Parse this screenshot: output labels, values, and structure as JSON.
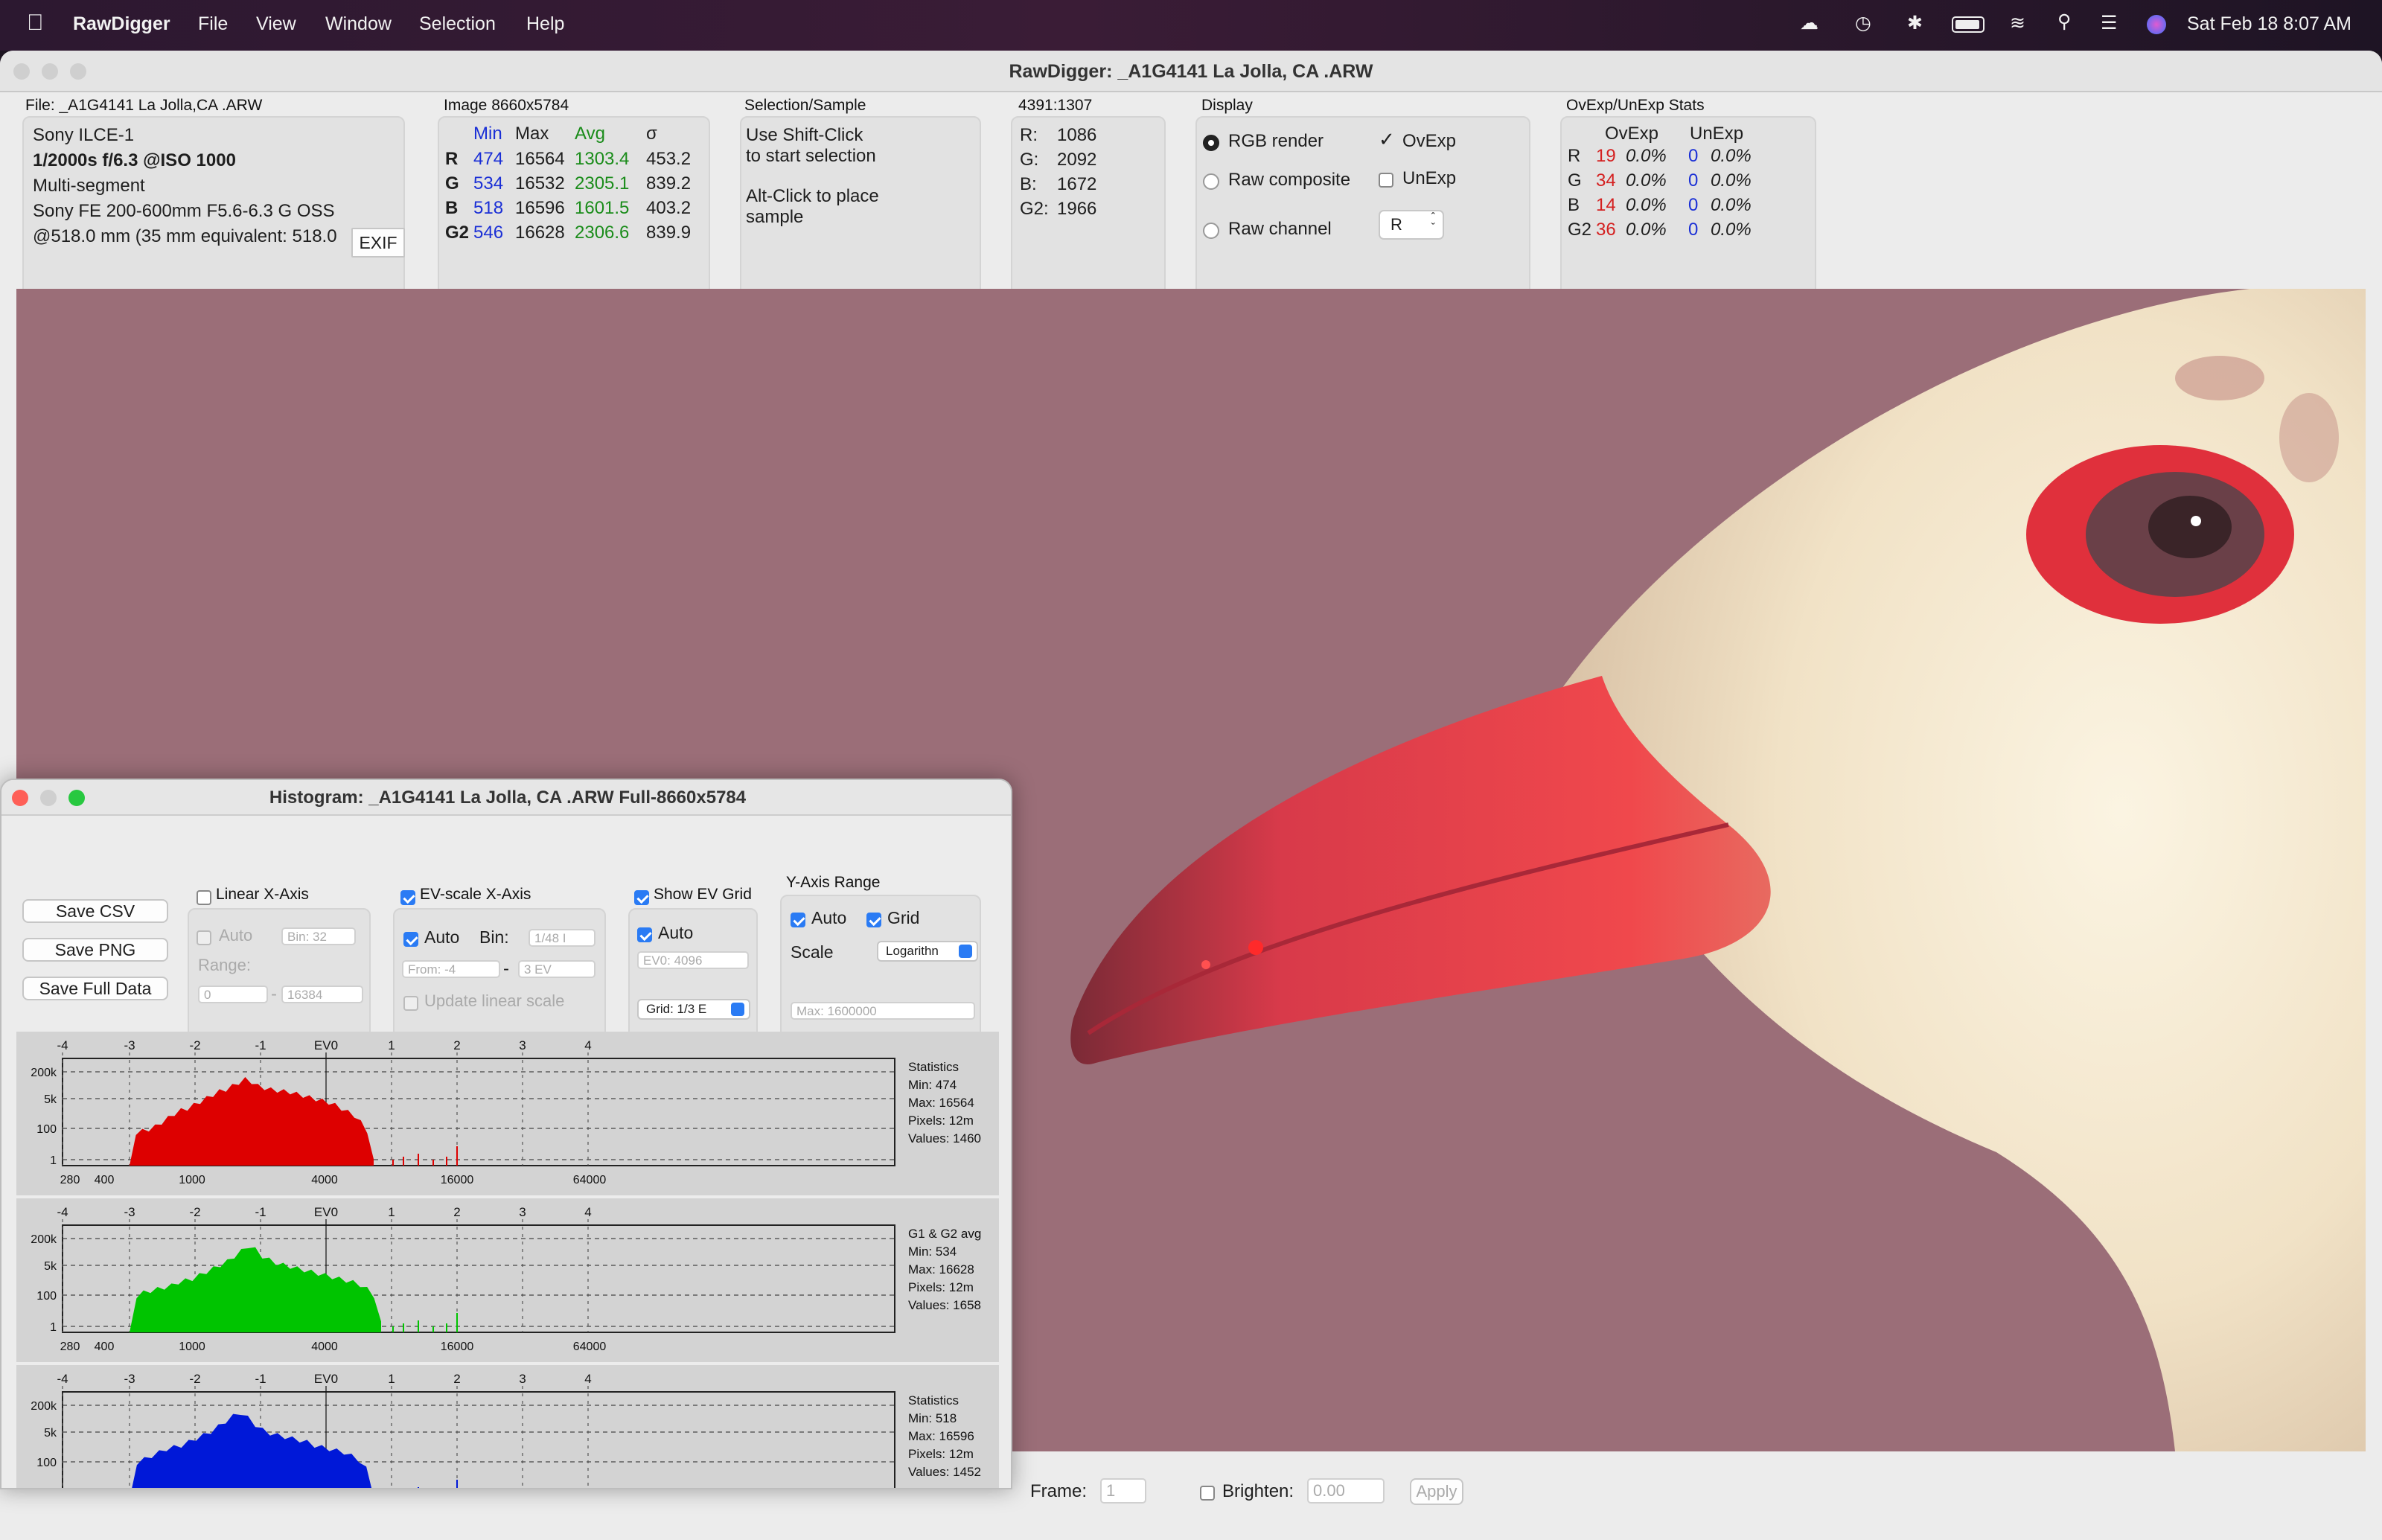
{
  "menubar": {
    "app": "RawDigger",
    "items": [
      "File",
      "View",
      "Window",
      "Selection",
      "Help"
    ],
    "clock": "Sat Feb 18  8:07 AM"
  },
  "window": {
    "title": "RawDigger: _A1G4141 La Jolla, CA .ARW"
  },
  "file_info": {
    "header": "File: _A1G4141 La Jolla,CA .ARW",
    "lines": [
      "Sony ILCE-1",
      "1/2000s f/6.3 @ISO 1000",
      "Multi-segment",
      "Sony FE 200-600mm F5.6-6.3 G OSS",
      "@518.0 mm (35 mm equivalent: 518.0"
    ],
    "exif_button": "EXIF"
  },
  "image_stats": {
    "header": "Image 8660x5784",
    "columns": [
      "Min",
      "Max",
      "Avg",
      "σ"
    ],
    "rows": [
      {
        "ch": "R",
        "min": "474",
        "max": "16564",
        "avg": "1303.4",
        "sd": "453.2"
      },
      {
        "ch": "G",
        "min": "534",
        "max": "16532",
        "avg": "2305.1",
        "sd": "839.2"
      },
      {
        "ch": "B",
        "min": "518",
        "max": "16596",
        "avg": "1601.5",
        "sd": "403.2"
      },
      {
        "ch": "G2",
        "min": "546",
        "max": "16628",
        "avg": "2306.6",
        "sd": "839.9"
      }
    ]
  },
  "selection": {
    "header": "Selection/Sample",
    "line1": "Use Shift-Click",
    "line2": "to start selection",
    "line3": "Alt-Click to place",
    "line4": "sample"
  },
  "pixel": {
    "header": "4391:1307",
    "rows": [
      {
        "ch": "R:",
        "v": "1086"
      },
      {
        "ch": "G:",
        "v": "2092"
      },
      {
        "ch": "B:",
        "v": "1672"
      },
      {
        "ch": "G2:",
        "v": "1966"
      }
    ]
  },
  "display": {
    "header": "Display",
    "rgb_render": "RGB render",
    "raw_composite": "Raw composite",
    "raw_channel": "Raw channel",
    "ovexp": "OvExp",
    "unexp": "UnExp",
    "channel_select": "R"
  },
  "ovexp_stats": {
    "header": "OvExp/UnExp Stats",
    "col1": "OvExp",
    "col2": "UnExp",
    "rows": [
      {
        "ch": "R",
        "ov": "19",
        "ovp": "0.0%",
        "un": "0",
        "unp": "0.0%"
      },
      {
        "ch": "G",
        "ov": "34",
        "ovp": "0.0%",
        "un": "0",
        "unp": "0.0%"
      },
      {
        "ch": "B",
        "ov": "14",
        "ovp": "0.0%",
        "un": "0",
        "unp": "0.0%"
      },
      {
        "ch": "G2",
        "ov": "36",
        "ovp": "0.0%",
        "un": "0",
        "unp": "0.0%"
      }
    ]
  },
  "bottom": {
    "frame_label": "Frame:",
    "frame_value": "1",
    "brighten_label": "Brighten:",
    "brighten_value": "0.00",
    "apply": "Apply"
  },
  "histogram": {
    "title": "Histogram: _A1G4141 La Jolla, CA .ARW Full-8660x5784",
    "buttons": [
      "Save CSV",
      "Save PNG",
      "Save Full Data"
    ],
    "linear": {
      "label": "Linear X-Axis",
      "auto": "Auto",
      "bin": "Bin: 32",
      "range": "Range:",
      "from": "0",
      "to": "16384"
    },
    "ev": {
      "label": "EV-scale X-Axis",
      "auto": "Auto",
      "bin_label": "Bin:",
      "bin": "1/48 I",
      "from": "From: -4",
      "to": "3 EV",
      "update": "Update linear scale"
    },
    "evgrid": {
      "label": "Show EV Grid",
      "auto": "Auto",
      "ev0": "EV0: 4096",
      "grid": "Grid: 1/3 E"
    },
    "yaxis": {
      "label": "Y-Axis Range",
      "auto": "Auto",
      "grid": "Grid",
      "scale_label": "Scale",
      "scale": "Logarithn",
      "max": "Max: 1600000"
    },
    "ev_ticks": [
      "-4",
      "-3",
      "-2",
      "-1",
      "EV0",
      "1",
      "2",
      "3",
      "4"
    ],
    "y_ticks": [
      "200k",
      "5k",
      "100",
      "1"
    ],
    "x_ticks": [
      "280",
      "400",
      "1000",
      "4000",
      "16000",
      "64000"
    ],
    "panels": [
      {
        "color": "#dd0000",
        "stats": [
          "Statistics",
          "Min: 474",
          "Max: 16564",
          "Pixels: 12m",
          "Values: 1460"
        ],
        "profile": [
          0,
          0.38,
          0.4,
          0.42,
          0.45,
          0.5,
          0.55,
          0.6,
          0.64,
          0.66,
          0.7,
          0.74,
          0.78,
          0.82,
          0.86,
          0.88,
          0.92,
          0.96,
          1.0,
          0.97,
          0.92,
          0.9,
          0.88,
          0.87,
          0.86,
          0.85,
          0.83,
          0.81,
          0.79,
          0.77,
          0.75,
          0.73,
          0.7,
          0.66,
          0.62,
          0.58,
          0.5,
          0.4,
          0.05
        ]
      },
      {
        "color": "#00c400",
        "stats": [
          "G1 & G2 avg",
          "Min: 534",
          "Max: 16628",
          "Pixels: 12m",
          "Values: 1658"
        ],
        "profile": [
          0,
          0.42,
          0.46,
          0.48,
          0.5,
          0.52,
          0.54,
          0.58,
          0.6,
          0.62,
          0.66,
          0.7,
          0.74,
          0.78,
          0.82,
          0.88,
          0.94,
          1.0,
          0.96,
          0.88,
          0.84,
          0.8,
          0.78,
          0.76,
          0.74,
          0.72,
          0.7,
          0.68,
          0.66,
          0.64,
          0.62,
          0.6,
          0.58,
          0.55,
          0.5,
          0.42,
          0.1
        ]
      },
      {
        "color": "#0018d8",
        "stats": [
          "Statistics",
          "Min: 518",
          "Max: 16596",
          "Pixels: 12m",
          "Values: 1452"
        ],
        "profile": [
          0,
          0.42,
          0.46,
          0.5,
          0.54,
          0.58,
          0.6,
          0.62,
          0.66,
          0.7,
          0.74,
          0.78,
          0.84,
          0.9,
          0.96,
          1.0,
          0.94,
          0.86,
          0.8,
          0.76,
          0.74,
          0.72,
          0.7,
          0.68,
          0.66,
          0.62,
          0.6,
          0.58,
          0.56,
          0.54,
          0.5,
          0.45,
          0.35,
          0.05
        ]
      }
    ]
  }
}
